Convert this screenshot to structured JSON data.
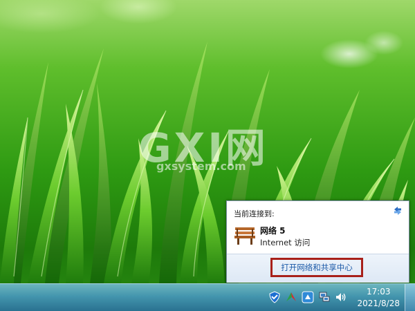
{
  "watermark": {
    "big": "GXI网",
    "small": "gxsystem.com"
  },
  "flyout": {
    "header": "当前连接到:",
    "network_name": "网络  5",
    "network_access": "Internet 访问",
    "open_center_link": "打开网络和共享中心"
  },
  "taskbar": {
    "tray_icons": [
      "shield-icon",
      "arrow-icon",
      "flag-icon",
      "network-icon",
      "speaker-icon"
    ],
    "clock_time": "17:03",
    "clock_date": "2021/8/28"
  },
  "colors": {
    "link": "#1c5aa8",
    "highlight_border": "#a8201a",
    "taskbar": "#3f8fb8"
  }
}
